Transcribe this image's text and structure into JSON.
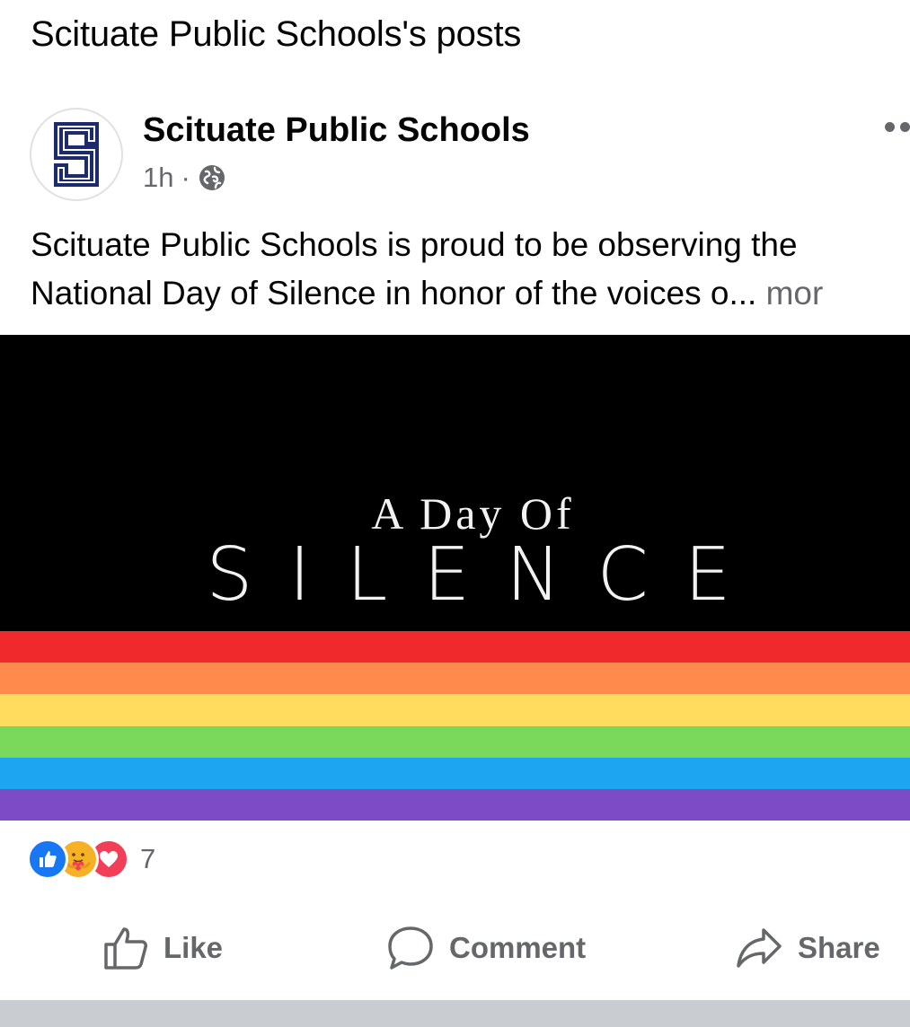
{
  "page": {
    "title": "Scituate Public Schools's posts"
  },
  "post": {
    "author": "Scituate Public Schools",
    "avatar_letter": "S",
    "time": "1h",
    "separator": "·",
    "privacy_icon": "globe-icon",
    "text_line1": "Scituate Public Schools is proud to be observing the",
    "text_line2": "National Day of Silence in honor of the voices o...",
    "see_more": " mor",
    "image": {
      "line1": "A Day Of",
      "line2": "SILENCE",
      "stripe_colors": [
        "#f02a2c",
        "#ff8a4c",
        "#ffdc5e",
        "#7ad85a",
        "#1ea5f2",
        "#7d4bc6"
      ]
    },
    "reactions": {
      "icons": [
        "like-icon",
        "care-icon",
        "love-icon"
      ],
      "colors": {
        "like": "#1877f2",
        "care": "#f7b125",
        "love": "#f33e58"
      },
      "count": "7"
    },
    "actions": {
      "like_label": "Like",
      "comment_label": "Comment",
      "share_label": "Share"
    }
  },
  "colors": {
    "secondary_text": "#65676b",
    "accent": "#1877f2",
    "avatar_navy": "#1c2a6e"
  }
}
